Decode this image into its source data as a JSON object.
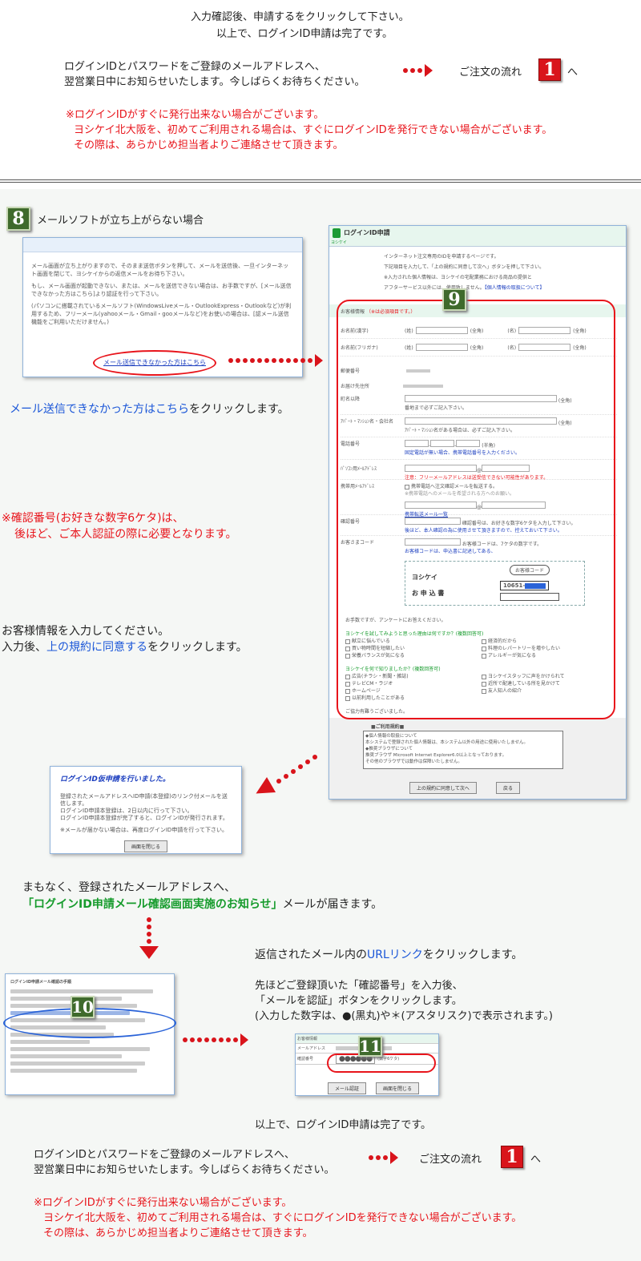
{
  "top": {
    "line1": "入力確認後、申請するをクリックして下さい。",
    "line2": "以上で、ログインID申請は完了です。",
    "notice1": "ログインIDとパスワードをご登録のメールアドレスへ、",
    "notice2": "翌営業日中にお知らせいたします。今しばらくお待ちください。",
    "flow_label": "ご注文の流れ",
    "flow_num": "1",
    "flow_suffix": "へ",
    "warn1": "※ログインIDがすぐに発行出来ない場合がございます。",
    "warn2": "ヨシケイ北大阪を、初めてご利用される場合は、すぐにログインIDを発行できない場合がございます。",
    "warn3": "その際は、あらかじめ担当者よりご連絡させて頂きます。"
  },
  "step8": {
    "num": "8",
    "title": "メールソフトが立ち上がらない場合",
    "shot_p1": "メール画面が立ち上がりますので、そのまま送信ボタンを押して、メールを送信後、一旦インターネット画面を閉じて、ヨシケイからの返信メールをお待ち下さい。",
    "shot_p2": "もし、メール画面が起動できない、または、メールを送信できない場合は、お手数ですが、[メール送信できなかった方はこちら]より認証を行って下さい。",
    "shot_p3": "(パソコンに搭載されているメールソフト(WindowsLiveメール・OutlookExpress・Outlookなど)が利用するため、フリーメール(yahooメール・Gmail・gooメールなど)をお使いの場合は、[認メール送信機能をご利用いただけません。)",
    "shot_link": "メール送信できなかった方はこちら",
    "instr_link": "メール送信できなかった方はこちら",
    "instr_rest": "をクリックします。",
    "confirm_note1": "※確認番号(お好きな数字6ケタ)は、",
    "confirm_note2": "後ほど、ご本人認証の際に必要となります。",
    "fill1": "お客様情報を入力してください。",
    "fill2_a": "入力後、",
    "fill2_link": "上の規約に同意する",
    "fill2_b": "をクリックします。"
  },
  "form": {
    "header": "ログインID申請",
    "logo": "ヨシケイ",
    "intro1": "インターネット注文専用のIDを申請するページです。",
    "intro2": "下記項目を入力して、「上の規約に同意して次へ」ボタンを押して下さい。",
    "intro3": "※入力された個人情報は、ヨシケイの宅配業務における商品の提供と",
    "intro4_a": "アフターサービス以外には、使用致しません。",
    "intro4_link": "【個人情報の取扱について】",
    "step_num": "9",
    "customer_info": "お客様情報",
    "required": "（※は必須項目です。）",
    "name_kanji": "お名前(漢字)",
    "name_kana": "お名前(フリガナ)",
    "sei": "(姓)",
    "mei": "(名)",
    "zenkaku": "(全角)",
    "hankaku": "(半角)",
    "zip": "郵便番号",
    "address": "お届け先住所",
    "street": "町名以降",
    "street_note": "番地まで必ずご記入下さい。",
    "building": "ｱﾊﾟｰﾄ・ﾏﾝｼｮﾝ名・会社名",
    "building_note": "ｱﾊﾟｰﾄ・ﾏﾝｼｮﾝ名がある場合は、必ずご記入下さい。",
    "phone": "電話番号",
    "phone_note": "固定電話が無い場合、携帯電話番号を入力ください。",
    "pc_mail": "ﾊﾟｿｺﾝ用ﾒｰﾙｱﾄﾞﾚｽ",
    "pc_mail_note": "注意：フリーメールアドレスは送受信できない可能性があります。",
    "mobile_mail": "携帯用ﾒｰﾙｱﾄﾞﾚｽ",
    "mobile_opt": "携帯電話へ注文確認メールを転送する。",
    "mobile_note": "※携帯電話へのメールを希望される方へのお願い。",
    "mobile_link": "携帯転送メール一覧",
    "confirm_code": "確認番号",
    "confirm_hint": "確認番号は、お好きな数字6ケタを入力して下さい。",
    "confirm_hint2": "後ほど、本人確認の為に使用させて頂きますので、控えておいて下さい。",
    "customer_code": "お客さまコード",
    "code_hint": "お客様コードは、7ケタの数字です。",
    "code_hint2": "お客様コードは、申込書に記述してある、",
    "code_bubble": "お客様コード",
    "card_brand": "ヨシケイ",
    "card_title": "お 申 込 書",
    "card_code": "10651-",
    "survey_intro": "お手数ですが、アンケートにお答えください。",
    "survey_q1": "ヨシケイを試してみようと思った理由は何ですか？(複数回答可)",
    "q1_opts": [
      "献立に悩んでいる",
      "経済的だから",
      "買い物時間を短縮したい",
      "料理のレパートリーを増やしたい",
      "栄養バランスが気になる",
      "アレルギーが気になる"
    ],
    "survey_q2": "ヨシケイを何で知りましたか？(複数回答可)",
    "q2_opts": [
      "広告(チラシ・新聞・雑誌)",
      "ヨシケイスタッフに声をかけられて",
      "テレビCM・ラジオ",
      "近所で配達している所を見かけて",
      "ホームページ",
      "友人知人の紹介",
      "以前利用したことがある"
    ],
    "thanks": "ご協力有難うございました。",
    "terms_title": "■ご利用規約■",
    "terms1": "◆個人情報の取扱について",
    "terms2": "本システムで登録された個人情報は、本システム以外の用途に使用いたしません。",
    "terms3": "◆推奨ブラウザについて",
    "terms4": "推奨ブラウザ Microsoft Internet Explorer6.0以上となっております。",
    "terms5": "その他のブラウザでは動作は保障いたしません。",
    "agree_btn": "上の規約に同意して次へ",
    "back_btn": "戻る"
  },
  "provisional": {
    "title": "ログインID仮申請を行いました。",
    "p1": "登録されたメールアドレスへID申請(本登録)のリンク付メールを送信します。",
    "p2": "ログインID申請本登録は、2日以内に行って下さい。",
    "p3": "ログインID申請本登録が完了すると、ログインIDが発行されます。",
    "p4": "※メールが届かない場合は、再度ログインID申請を行って下さい。",
    "close_btn": "画面を閉じる"
  },
  "mail": {
    "line1": "まもなく、登録されたメールアドレスへ、",
    "highlight": "「ログインID申請メール確認画面実施のお知らせ」",
    "line2_rest": "メールが届きます。"
  },
  "step10": {
    "num": "10",
    "shot_title": "ログインID申請メール確認の手順",
    "url_a": "返信されたメール内の",
    "url_link": "URLリンク",
    "url_b": "をクリックします。",
    "code1": "先ほどご登録頂いた「確認番号」を入力後、",
    "code2": "「メールを認証」ボタンをクリックします。",
    "code3": "(入力した数字は、●(黒丸)や＊(アスタリスク)で表示されます。)"
  },
  "step11": {
    "num": "11",
    "r1": "お客様情報",
    "r2": "メールアドレス",
    "r3": "確認番号",
    "masked": "●●●●●●",
    "digits": "(数字6ケタ)",
    "auth_btn": "メール認証",
    "close_btn": "画面を閉じる"
  },
  "bottom": {
    "done": "以上で、ログインID申請は完了です。",
    "notice1": "ログインIDとパスワードをご登録のメールアドレスへ、",
    "notice2": "翌営業日中にお知らせいたします。今しばらくお待ちください。",
    "flow_label": "ご注文の流れ",
    "flow_num": "1",
    "flow_suffix": "へ",
    "warn1": "※ログインIDがすぐに発行出来ない場合がございます。",
    "warn2": "ヨシケイ北大阪を、初めてご利用される場合は、すぐにログインIDを発行できない場合がございます。",
    "warn3": "その際は、あらかじめ担当者よりご連絡させて頂きます。"
  },
  "colors": {
    "accent_red": "#d9141b",
    "link_blue": "#1a56d8",
    "highlight_green": "#169b2c",
    "step_green": "#3f6a2c"
  }
}
